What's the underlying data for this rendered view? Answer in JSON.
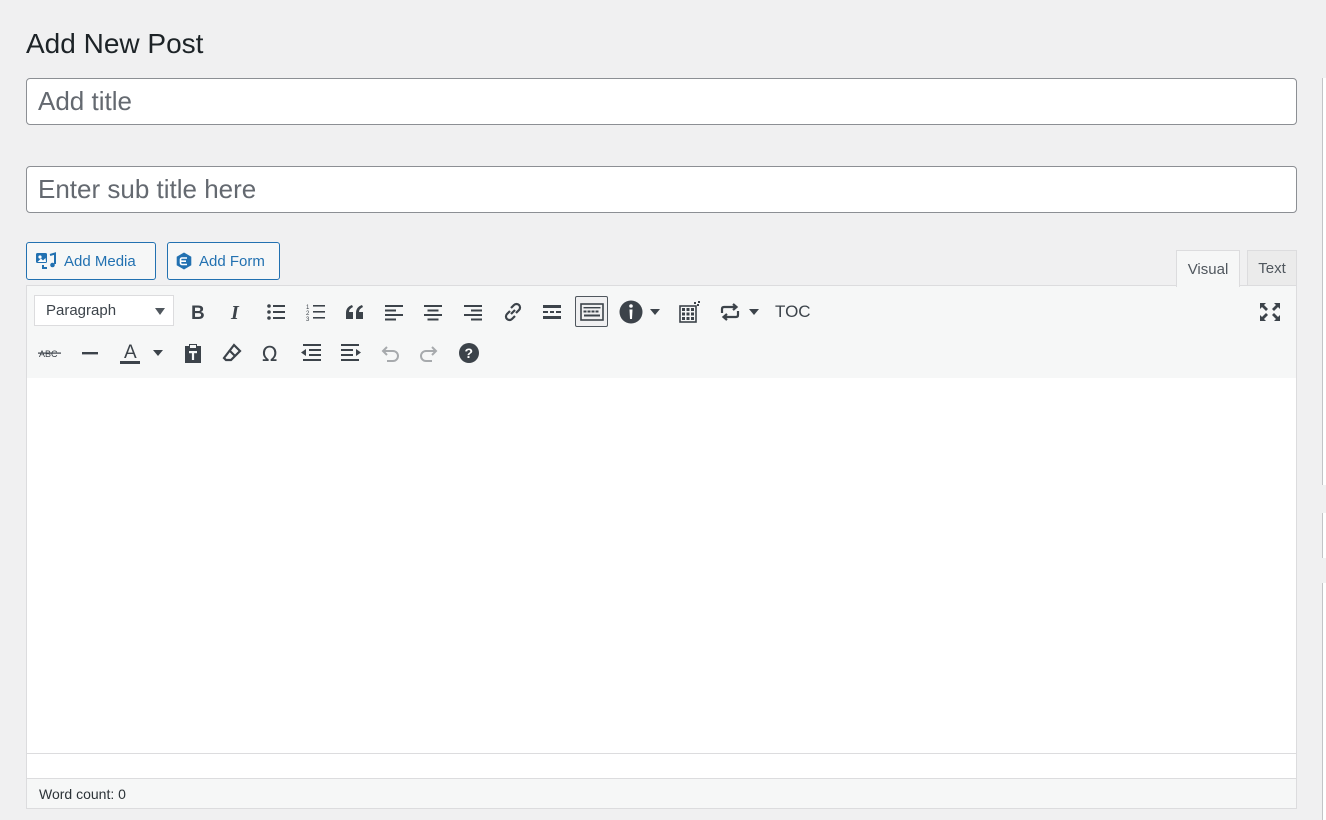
{
  "page": {
    "title": "Add New Post"
  },
  "title_field": {
    "placeholder": "Add title"
  },
  "subtitle_field": {
    "placeholder": "Enter sub title here"
  },
  "media_buttons": {
    "add_media": "Add Media",
    "add_form": "Add Form"
  },
  "editor_tabs": {
    "visual": "Visual",
    "text": "Text"
  },
  "toolbar": {
    "format_select": "Paragraph",
    "toc_label": "TOC",
    "row1_icons": [
      "bold-icon",
      "italic-icon",
      "bulleted-list-icon",
      "numbered-list-icon",
      "blockquote-icon",
      "align-left-icon",
      "align-center-icon",
      "align-right-icon",
      "link-icon",
      "read-more-icon",
      "toolbar-toggle-icon",
      "info-icon",
      "table-icon",
      "loop-icon",
      "fullscreen-icon"
    ],
    "row2_icons": [
      "strikethrough-icon",
      "horizontal-line-icon",
      "text-color-icon",
      "paste-text-icon",
      "clear-formatting-icon",
      "special-character-icon",
      "outdent-icon",
      "indent-icon",
      "undo-icon",
      "redo-icon",
      "help-icon"
    ]
  },
  "status_bar": {
    "word_count": "Word count: 0"
  },
  "colors": {
    "accent": "#2271b1",
    "background": "#f0f0f1",
    "toolbar": "#f6f7f7",
    "border": "#dcdcde"
  }
}
